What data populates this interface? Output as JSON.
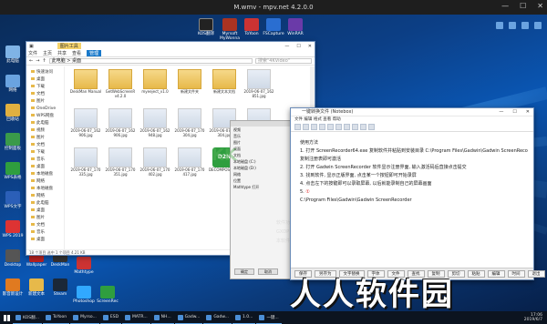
{
  "window": {
    "title": "M.wmv - mpv.net 4.2.0.0"
  },
  "desktop_icons_left": [
    "此电脑",
    "网络",
    "回收站",
    "控制面板",
    "WPS表格",
    "WPS文字",
    "WPS 2019",
    "Desktop",
    "影音新设计",
    "Wallpaper",
    "新建文本",
    "DeskMan",
    "Steam",
    "Mathtype",
    "Photoshop",
    "ScreenRec"
  ],
  "desktop_icons_top": [
    {
      "label": "KOS翻译",
      "name": "kos-icon"
    },
    {
      "label": "Myrsoft MyWonna",
      "name": "app-icon"
    },
    {
      "label": "ToYoon",
      "name": "app-icon"
    },
    {
      "label": "FSCapture",
      "name": "capture-icon"
    },
    {
      "label": "WinRAR",
      "name": "archive-icon"
    }
  ],
  "explorer": {
    "tabs": [
      "文件",
      "主页",
      "共享",
      "查看"
    ],
    "context_tab": "图片工具",
    "active_tab": "管理",
    "path": "此电脑 > 桌面",
    "search_placeholder": "搜索\"4KVideo\"",
    "nav": [
      "快速访问",
      "桌面",
      "下载",
      "文档",
      "图片",
      "OneDrive",
      "WPS网盘",
      "此电脑",
      "视频",
      "图片",
      "文档",
      "下载",
      "音乐",
      "桌面",
      "本地磁盘",
      "网络"
    ],
    "files": [
      {
        "name": "DeskMan Manual",
        "type": "folder"
      },
      {
        "name": "GetWebScreenR v4.2.0",
        "type": "folder"
      },
      {
        "name": "myeeject_v1.0",
        "type": "folder"
      },
      {
        "name": "新建文件夹",
        "type": "folder"
      },
      {
        "name": "新建文本文档",
        "type": "folder"
      },
      {
        "name": "2019-06-07_162 851.jpg",
        "type": "image"
      },
      {
        "name": "2019-06-07_162 906.jpg",
        "type": "image"
      },
      {
        "name": "2019-06-07_162 906.jpg",
        "type": "image"
      },
      {
        "name": "2019-06-07_162 948.jpg",
        "type": "image"
      },
      {
        "name": "2019-06-07_170 304.jpg",
        "type": "image"
      },
      {
        "name": "2019-06-07_170 304.jpg",
        "type": "image"
      },
      {
        "name": "2019-06-07_170 326.jpg",
        "type": "image"
      },
      {
        "name": "2019-06-07_170 335.jpg",
        "type": "image"
      },
      {
        "name": "2019-06-07_170 351.jpg",
        "type": "image"
      },
      {
        "name": "2019-06-07_170 402.jpg",
        "type": "image"
      },
      {
        "name": "2019-06-07_170 417.jpg",
        "type": "image"
      },
      {
        "name": "DECOMPOSITION",
        "type": "ntod",
        "badge": "D2N"
      },
      {
        "name": "Note2Desk",
        "type": "ntod",
        "badge": "N2D"
      }
    ],
    "status": "18 个项目  选中 1 个项目 4.21 KB"
  },
  "props_panel": {
    "rows": [
      "视频",
      "音乐",
      "图片",
      "桌面",
      "文档",
      "本地磁盘 (C:)",
      "本地磁盘 (D:)",
      "网络",
      "位置",
      "Mathtype 打开"
    ],
    "ok": "确定",
    "cancel": "取消"
  },
  "editor": {
    "title": "一键转换文件 (Notebox)",
    "menu": "文件  编辑  格式  查看  帮助",
    "lines": [
      "使用方法",
      "1. 打开 ScreenRecorder64.exe 复制软件并粘贴到安装目录 C:\\Program Files\\Gadwin\\Gadwin ScreenRecorder, 点击替换",
      "    复制注册表即可激活",
      "2. 打开 Gadwin ScreenRecorder 软件显示注册界面, 输入激活码后直接点击提交",
      "3. 找到软件, 显示正版界面, 点击某一个按钮即可开始录屏",
      "4. 点击左下的按键即可以录取屏幕, 以后就能录制自己的屏幕画面",
      "5.  ",
      "C:\\Program Files\\Gadwin\\Gadwin ScreenRecorder"
    ],
    "marker": "①",
    "buttons": [
      "保存",
      "另存为",
      "文字替换",
      "字体",
      "文件",
      "查找",
      "复制",
      "剪切",
      "粘贴",
      "编辑",
      "时间",
      "退出"
    ]
  },
  "side_text": [
    "软件功能",
    "GXDP Thumbnails",
    "本软件的功能主要是"
  ],
  "watermark": "人人软件园",
  "taskbar": {
    "items": [
      "KOS翻...",
      "ToYoon",
      "Myrso...",
      "ESD",
      "MATR...",
      "NH...",
      "Gadw...",
      "Gadw...",
      "1.0...",
      "一键..."
    ],
    "time": "17:06",
    "date": "2019/6/7"
  }
}
